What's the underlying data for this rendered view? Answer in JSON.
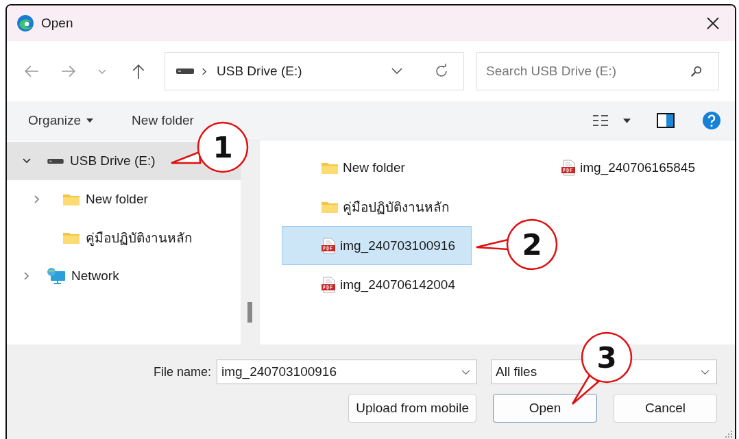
{
  "window": {
    "title": "Open"
  },
  "nav": {
    "path": "USB Drive (E:)",
    "search": {
      "placeholder": "Search USB Drive (E:)"
    }
  },
  "toolbar": {
    "organize": "Organize",
    "new_folder": "New folder"
  },
  "tree": [
    {
      "kind": "drive",
      "label": "USB Drive (E:)",
      "selected": true,
      "expandable": true,
      "expanded": true,
      "children": [
        {
          "kind": "folder",
          "label": "New folder",
          "selected": false,
          "expandable": true,
          "expanded": false
        },
        {
          "kind": "folder",
          "label": "คู่มือปฏิบัติงานหลัก",
          "selected": false,
          "expandable": false
        }
      ]
    },
    {
      "kind": "network",
      "label": "Network",
      "selected": false,
      "expandable": true,
      "expanded": false
    }
  ],
  "files": [
    {
      "kind": "folder",
      "name": "New folder",
      "selected": false
    },
    {
      "kind": "folder",
      "name": "คู่มือปฏิบัติงานหลัก",
      "selected": false
    },
    {
      "kind": "pdf",
      "name": "img_240703100916",
      "selected": true
    },
    {
      "kind": "pdf",
      "name": "img_240706142004",
      "selected": false
    },
    {
      "kind": "pdf",
      "name": "img_240706165845",
      "selected": false
    }
  ],
  "file_name": {
    "label": "File name:",
    "value": "img_240703100916"
  },
  "file_type": {
    "value": "All files"
  },
  "buttons": [
    {
      "label": "Upload from mobile",
      "kind": "secondary"
    },
    {
      "label": "Open",
      "kind": "default"
    },
    {
      "label": "Cancel",
      "kind": "secondary"
    }
  ],
  "callouts": [
    {
      "number": "1"
    },
    {
      "number": "2"
    },
    {
      "number": "3"
    }
  ]
}
